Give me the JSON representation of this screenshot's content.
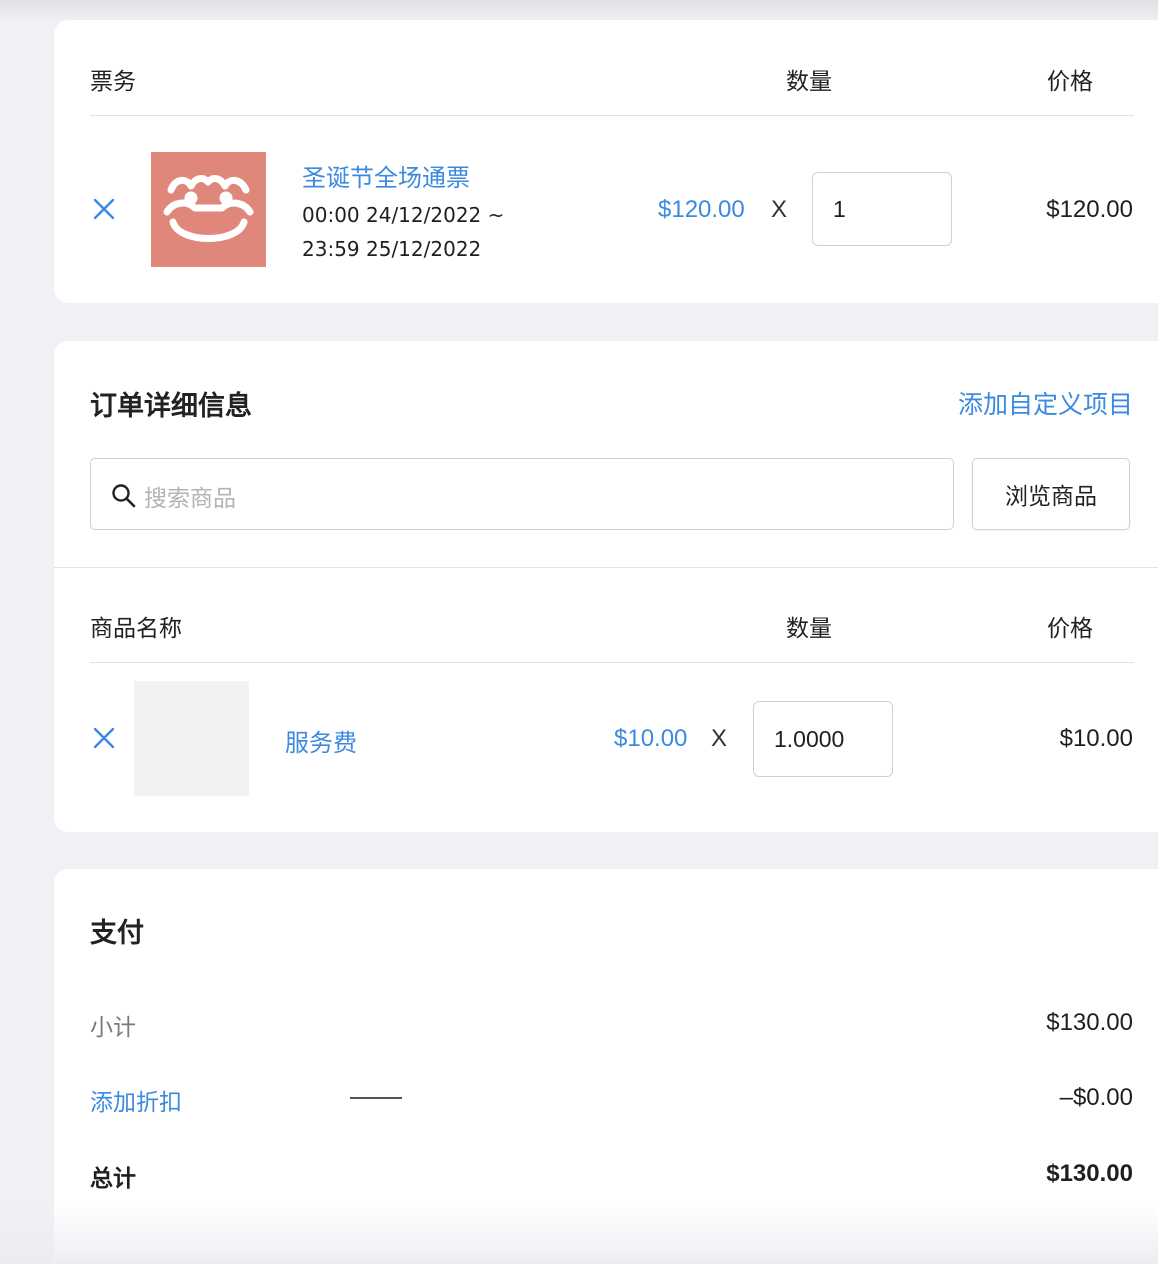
{
  "tickets": {
    "col_name": "票务",
    "col_qty": "数量",
    "col_price": "价格",
    "items": [
      {
        "name": "圣诞节全场通票",
        "time_line1": "00:00 24/12/2022 ~",
        "time_line2": "23:59 25/12/2022",
        "unit_price": "$120.00",
        "times": "X",
        "quantity": "1",
        "total": "$120.00",
        "thumb_color": "#e0877b"
      }
    ]
  },
  "order_details": {
    "title": "订单详细信息",
    "add_custom": "添加自定义项目",
    "search_placeholder": "搜索商品",
    "browse_label": "浏览商品",
    "col_name": "商品名称",
    "col_qty": "数量",
    "col_price": "价格",
    "items": [
      {
        "name": "服务费",
        "unit_price": "$10.00",
        "times": "X",
        "quantity": "1.0000",
        "total": "$10.00"
      }
    ]
  },
  "payment": {
    "title": "支付",
    "subtotal_label": "小计",
    "subtotal_value": "$130.00",
    "discount_label": "添加折扣",
    "discount_value": "–$0.00",
    "total_label": "总计",
    "total_value": "$130.00"
  },
  "colors": {
    "accent": "#3b8ae0",
    "background": "#f0f1f5"
  }
}
